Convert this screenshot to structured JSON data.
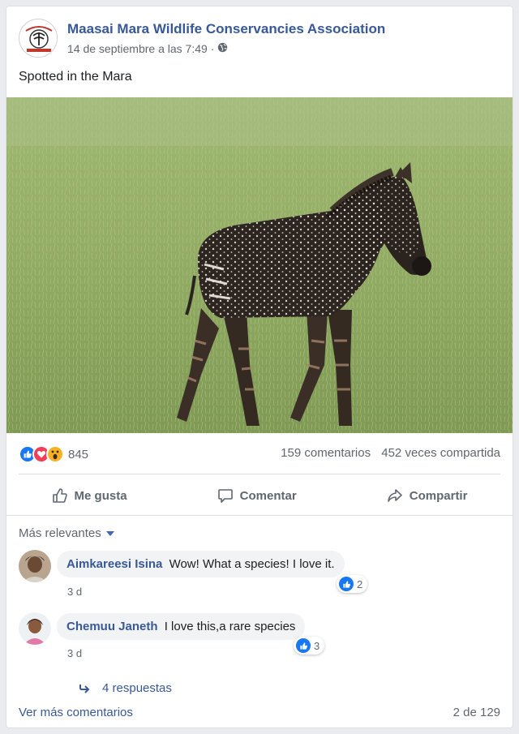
{
  "post": {
    "page_name": "Maasai Mara Wildlife Conservancies Association",
    "timestamp": "14 de septiembre a las 7:49",
    "separator": "·",
    "privacy_icon": "globe-icon",
    "text": "Spotted in the Mara",
    "avatar": {
      "icon": "conservancy-logo",
      "logo_lettering": "MAASAI MARA WILDLIFE CONSERVANCIES"
    },
    "photo": {
      "icon": "photo",
      "subject": "spotted zebra foal on grassland"
    }
  },
  "reactions": {
    "icons": [
      "like-icon",
      "love-icon",
      "wow-icon"
    ],
    "count": "845",
    "comments": "159 comentarios",
    "shares": "452 veces compartida"
  },
  "actions": {
    "like": "Me gusta",
    "comment": "Comentar",
    "share": "Compartir"
  },
  "comments": {
    "sort_label": "Más relevantes",
    "items": [
      {
        "author": "Aimkareesi Isina",
        "text": "Wow! What a species! I love it.",
        "time": "3 d",
        "likes": "2"
      },
      {
        "author": "Chemuu Janeth",
        "text": "I love this,a rare species",
        "time": "3 d",
        "likes": "3"
      }
    ],
    "replies_label": "4 respuestas",
    "more_label": "Ver más comentarios",
    "pager": "2 de 129"
  },
  "colors": {
    "brand_link": "#385898",
    "secondary_text": "#606770",
    "like_blue": "#1877f2",
    "love_red": "#f33e58",
    "wow_yellow": "#f7b125"
  }
}
